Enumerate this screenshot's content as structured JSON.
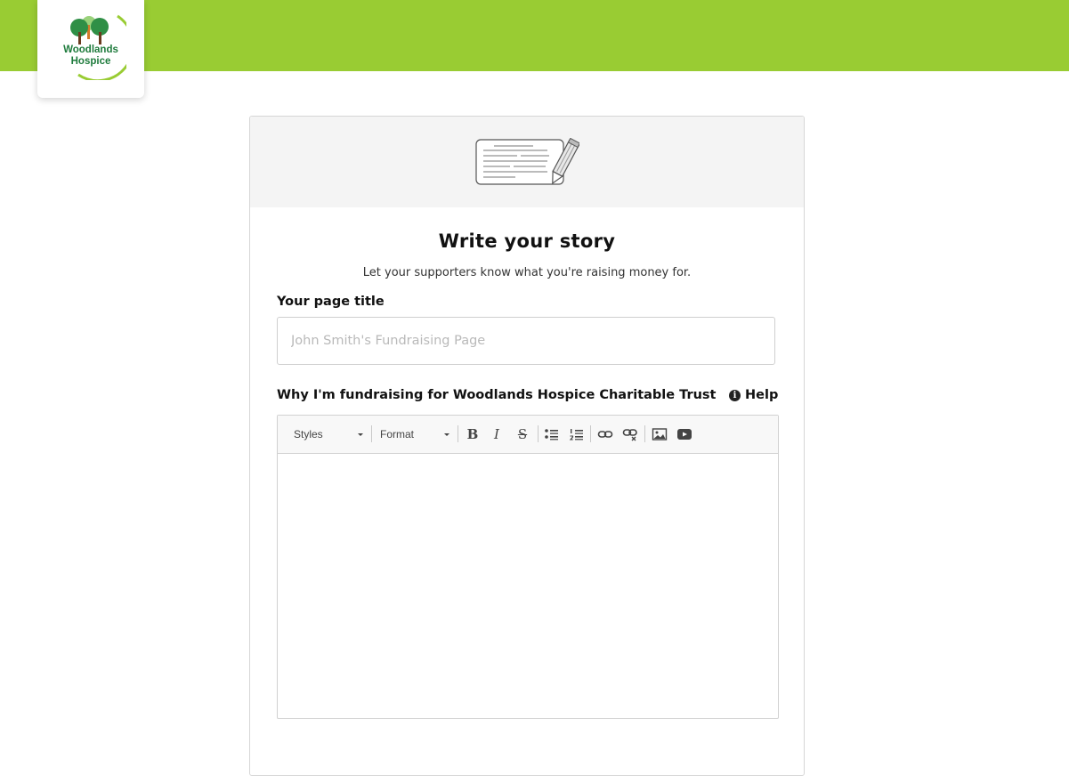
{
  "brand": {
    "logo_line1": "Woodlands",
    "logo_line2": "Hospice",
    "header_color": "#99cc33",
    "logo_green": "#1e7b3c"
  },
  "story": {
    "title": "Write your story",
    "subtitle": "Let your supporters know what you're raising money for.",
    "header_icon": "story-card-pencil-icon"
  },
  "form": {
    "page_title_label": "Your page title",
    "page_title_placeholder": "John Smith's Fundraising Page",
    "page_title_value": "",
    "why_label": "Why I'm fundraising for Woodlands Hospice Charitable Trust",
    "help_label": "Help",
    "help_icon": "info-circle-icon"
  },
  "editor": {
    "styles_label": "Styles",
    "format_label": "Format",
    "tools": [
      "bold",
      "italic",
      "strikethrough",
      "bulleted-list",
      "numbered-list",
      "link",
      "unlink",
      "image",
      "video"
    ],
    "bold_glyph": "B",
    "italic_glyph": "I",
    "strike_glyph": "S",
    "content": ""
  }
}
